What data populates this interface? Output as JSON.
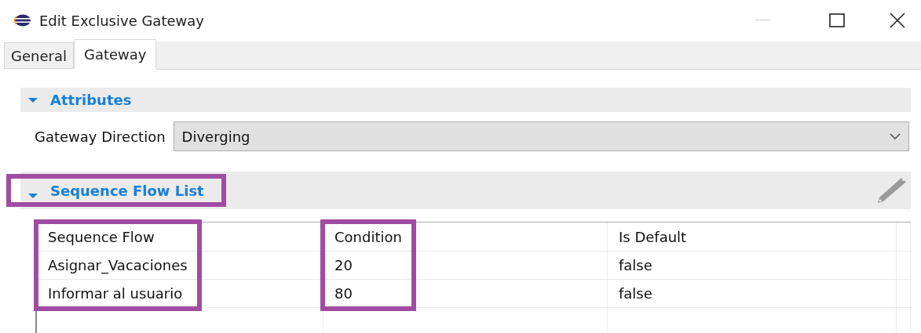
{
  "window": {
    "title": "Edit Exclusive Gateway"
  },
  "tabs": [
    {
      "label": "General",
      "selected": false
    },
    {
      "label": "Gateway",
      "selected": true
    }
  ],
  "sections": [
    {
      "kind": "attributes",
      "title": "Attributes",
      "expanded": true,
      "highlighted": false,
      "fields": [
        {
          "label": "Gateway Direction",
          "value": "Diverging"
        }
      ]
    },
    {
      "kind": "table",
      "title": "Sequence Flow List",
      "expanded": true,
      "highlighted": true,
      "columns": [
        {
          "label": "Sequence Flow",
          "highlighted": true
        },
        {
          "label": "Condition",
          "highlighted": true
        },
        {
          "label": "Is Default",
          "highlighted": false
        }
      ],
      "rows": [
        [
          "Asignar_Vacaciones",
          "20",
          "false"
        ],
        [
          "Informar al usuario",
          "80",
          "false"
        ]
      ]
    }
  ]
}
